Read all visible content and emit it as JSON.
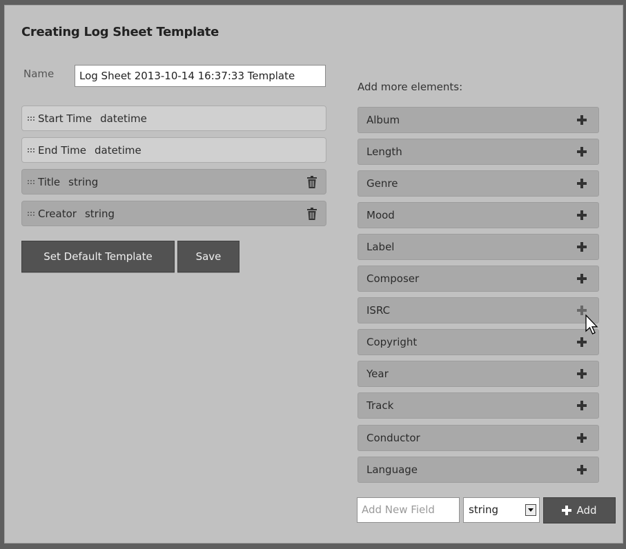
{
  "dialog": {
    "title": "Creating Log Sheet Template",
    "name_label": "Name",
    "name_value": "Log Sheet 2013-10-14 16:37:33 Template"
  },
  "fields": [
    {
      "name": "Start Time",
      "type": "datetime",
      "deletable": false
    },
    {
      "name": "End Time",
      "type": "datetime",
      "deletable": false
    },
    {
      "name": "Title",
      "type": "string",
      "deletable": true
    },
    {
      "name": "Creator",
      "type": "string",
      "deletable": true
    }
  ],
  "buttons": {
    "set_default": "Set Default Template",
    "save": "Save"
  },
  "more": {
    "label": "Add more elements:",
    "items": [
      "Album",
      "Length",
      "Genre",
      "Mood",
      "Label",
      "Composer",
      "ISRC",
      "Copyright",
      "Year",
      "Track",
      "Conductor",
      "Language"
    ]
  },
  "new_field": {
    "placeholder": "Add New Field",
    "type_value": "string",
    "add_label": "Add"
  },
  "icons": {
    "grip": "drag-handle-icon",
    "trash": "trash-icon",
    "plus": "plus-icon",
    "dropdown": "chevron-down-icon",
    "cursor": "mouse-pointer-icon"
  },
  "colors": {
    "panel_bg": "#c1c1c1",
    "button_bg": "#525252",
    "row_dark": "#a9a9a9",
    "row_light": "#d0d0d0"
  }
}
